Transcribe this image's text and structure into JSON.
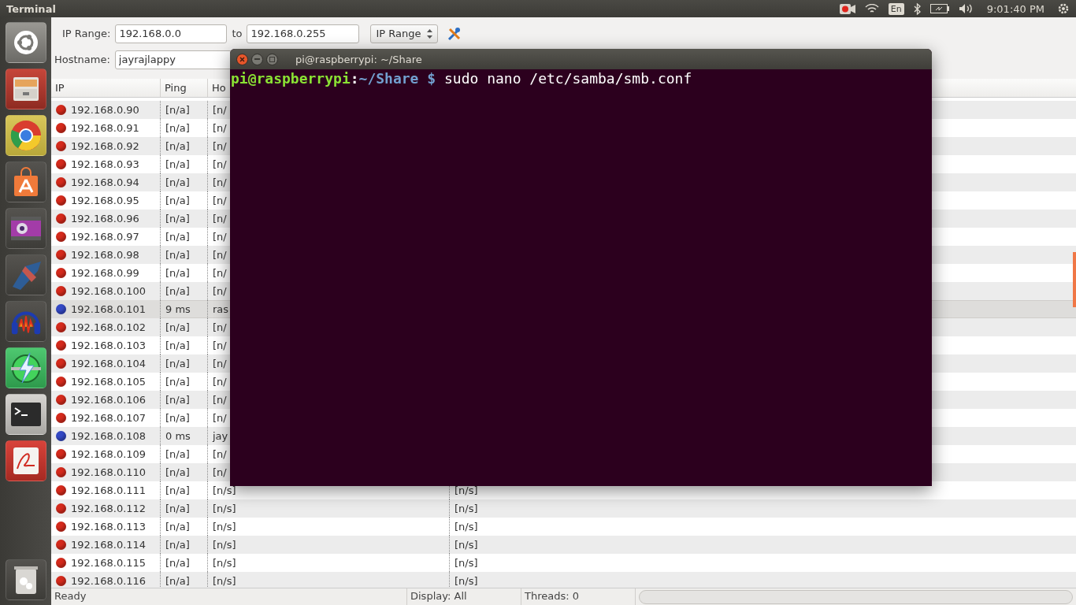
{
  "top_panel": {
    "title": "Terminal",
    "keyboard_layout": "En",
    "clock": "9:01:40 PM"
  },
  "scanner": {
    "ip_range_label": "IP Range:",
    "range_start": "192.168.0.0",
    "to_label": "to",
    "range_end": "192.168.0.255",
    "mode": "IP Range",
    "hostname_label": "Hostname:",
    "hostname": "jayrajlappy"
  },
  "table": {
    "columns": [
      "IP",
      "Ping",
      "Ho"
    ],
    "rows": [
      {
        "ip": "192.168.0.90",
        "ping": "[n/a]",
        "hostname": "[n/",
        "color": "#d42a1c",
        "selected": false
      },
      {
        "ip": "192.168.0.91",
        "ping": "[n/a]",
        "hostname": "[n/",
        "color": "#d42a1c",
        "selected": false
      },
      {
        "ip": "192.168.0.92",
        "ping": "[n/a]",
        "hostname": "[n/",
        "color": "#d42a1c",
        "selected": false
      },
      {
        "ip": "192.168.0.93",
        "ping": "[n/a]",
        "hostname": "[n/",
        "color": "#d42a1c",
        "selected": false
      },
      {
        "ip": "192.168.0.94",
        "ping": "[n/a]",
        "hostname": "[n/",
        "color": "#d42a1c",
        "selected": false
      },
      {
        "ip": "192.168.0.95",
        "ping": "[n/a]",
        "hostname": "[n/",
        "color": "#d42a1c",
        "selected": false
      },
      {
        "ip": "192.168.0.96",
        "ping": "[n/a]",
        "hostname": "[n/",
        "color": "#d42a1c",
        "selected": false
      },
      {
        "ip": "192.168.0.97",
        "ping": "[n/a]",
        "hostname": "[n/",
        "color": "#d42a1c",
        "selected": false
      },
      {
        "ip": "192.168.0.98",
        "ping": "[n/a]",
        "hostname": "[n/",
        "color": "#d42a1c",
        "selected": false
      },
      {
        "ip": "192.168.0.99",
        "ping": "[n/a]",
        "hostname": "[n/",
        "color": "#d42a1c",
        "selected": false
      },
      {
        "ip": "192.168.0.100",
        "ping": "[n/a]",
        "hostname": "[n/",
        "color": "#d42a1c",
        "selected": false
      },
      {
        "ip": "192.168.0.101",
        "ping": "9 ms",
        "hostname": "ras",
        "color": "#3348c4",
        "selected": true
      },
      {
        "ip": "192.168.0.102",
        "ping": "[n/a]",
        "hostname": "[n/",
        "color": "#d42a1c",
        "selected": false
      },
      {
        "ip": "192.168.0.103",
        "ping": "[n/a]",
        "hostname": "[n/",
        "color": "#d42a1c",
        "selected": false
      },
      {
        "ip": "192.168.0.104",
        "ping": "[n/a]",
        "hostname": "[n/",
        "color": "#d42a1c",
        "selected": false
      },
      {
        "ip": "192.168.0.105",
        "ping": "[n/a]",
        "hostname": "[n/",
        "color": "#d42a1c",
        "selected": false
      },
      {
        "ip": "192.168.0.106",
        "ping": "[n/a]",
        "hostname": "[n/",
        "color": "#d42a1c",
        "selected": false
      },
      {
        "ip": "192.168.0.107",
        "ping": "[n/a]",
        "hostname": "[n/",
        "color": "#d42a1c",
        "selected": false
      },
      {
        "ip": "192.168.0.108",
        "ping": "0 ms",
        "hostname": "jay",
        "color": "#3348c4",
        "selected": false
      },
      {
        "ip": "192.168.0.109",
        "ping": "[n/a]",
        "hostname": "[n/",
        "color": "#d42a1c",
        "selected": false
      },
      {
        "ip": "192.168.0.110",
        "ping": "[n/a]",
        "hostname": "[n/",
        "color": "#d42a1c",
        "selected": false
      },
      {
        "ip": "192.168.0.111",
        "ping": "[n/a]",
        "hostname": "[n/s]",
        "column_4": "[n/s]",
        "color": "#d42a1c",
        "selected": false
      },
      {
        "ip": "192.168.0.112",
        "ping": "[n/a]",
        "hostname": "[n/s]",
        "column_4": "[n/s]",
        "color": "#d42a1c",
        "selected": false
      },
      {
        "ip": "192.168.0.113",
        "ping": "[n/a]",
        "hostname": "[n/s]",
        "column_4": "[n/s]",
        "color": "#d42a1c",
        "selected": false
      },
      {
        "ip": "192.168.0.114",
        "ping": "[n/a]",
        "hostname": "[n/s]",
        "column_4": "[n/s]",
        "color": "#d42a1c",
        "selected": false
      },
      {
        "ip": "192.168.0.115",
        "ping": "[n/a]",
        "hostname": "[n/s]",
        "column_4": "[n/s]",
        "color": "#d42a1c",
        "selected": false
      },
      {
        "ip": "192.168.0.116",
        "ping": "[n/a]",
        "hostname": "[n/s]",
        "column_4": "[n/s]",
        "color": "#d42a1c",
        "selected": false
      }
    ]
  },
  "status_bar": {
    "status": "Ready",
    "display": "Display: All",
    "threads": "Threads: 0"
  },
  "terminal": {
    "title": "pi@raspberrypi: ~/Share",
    "user": "pi@raspberrypi",
    "separator": ":",
    "path": "~/Share",
    "symbol": "$",
    "command": "sudo nano /etc/samba/smb.conf"
  }
}
